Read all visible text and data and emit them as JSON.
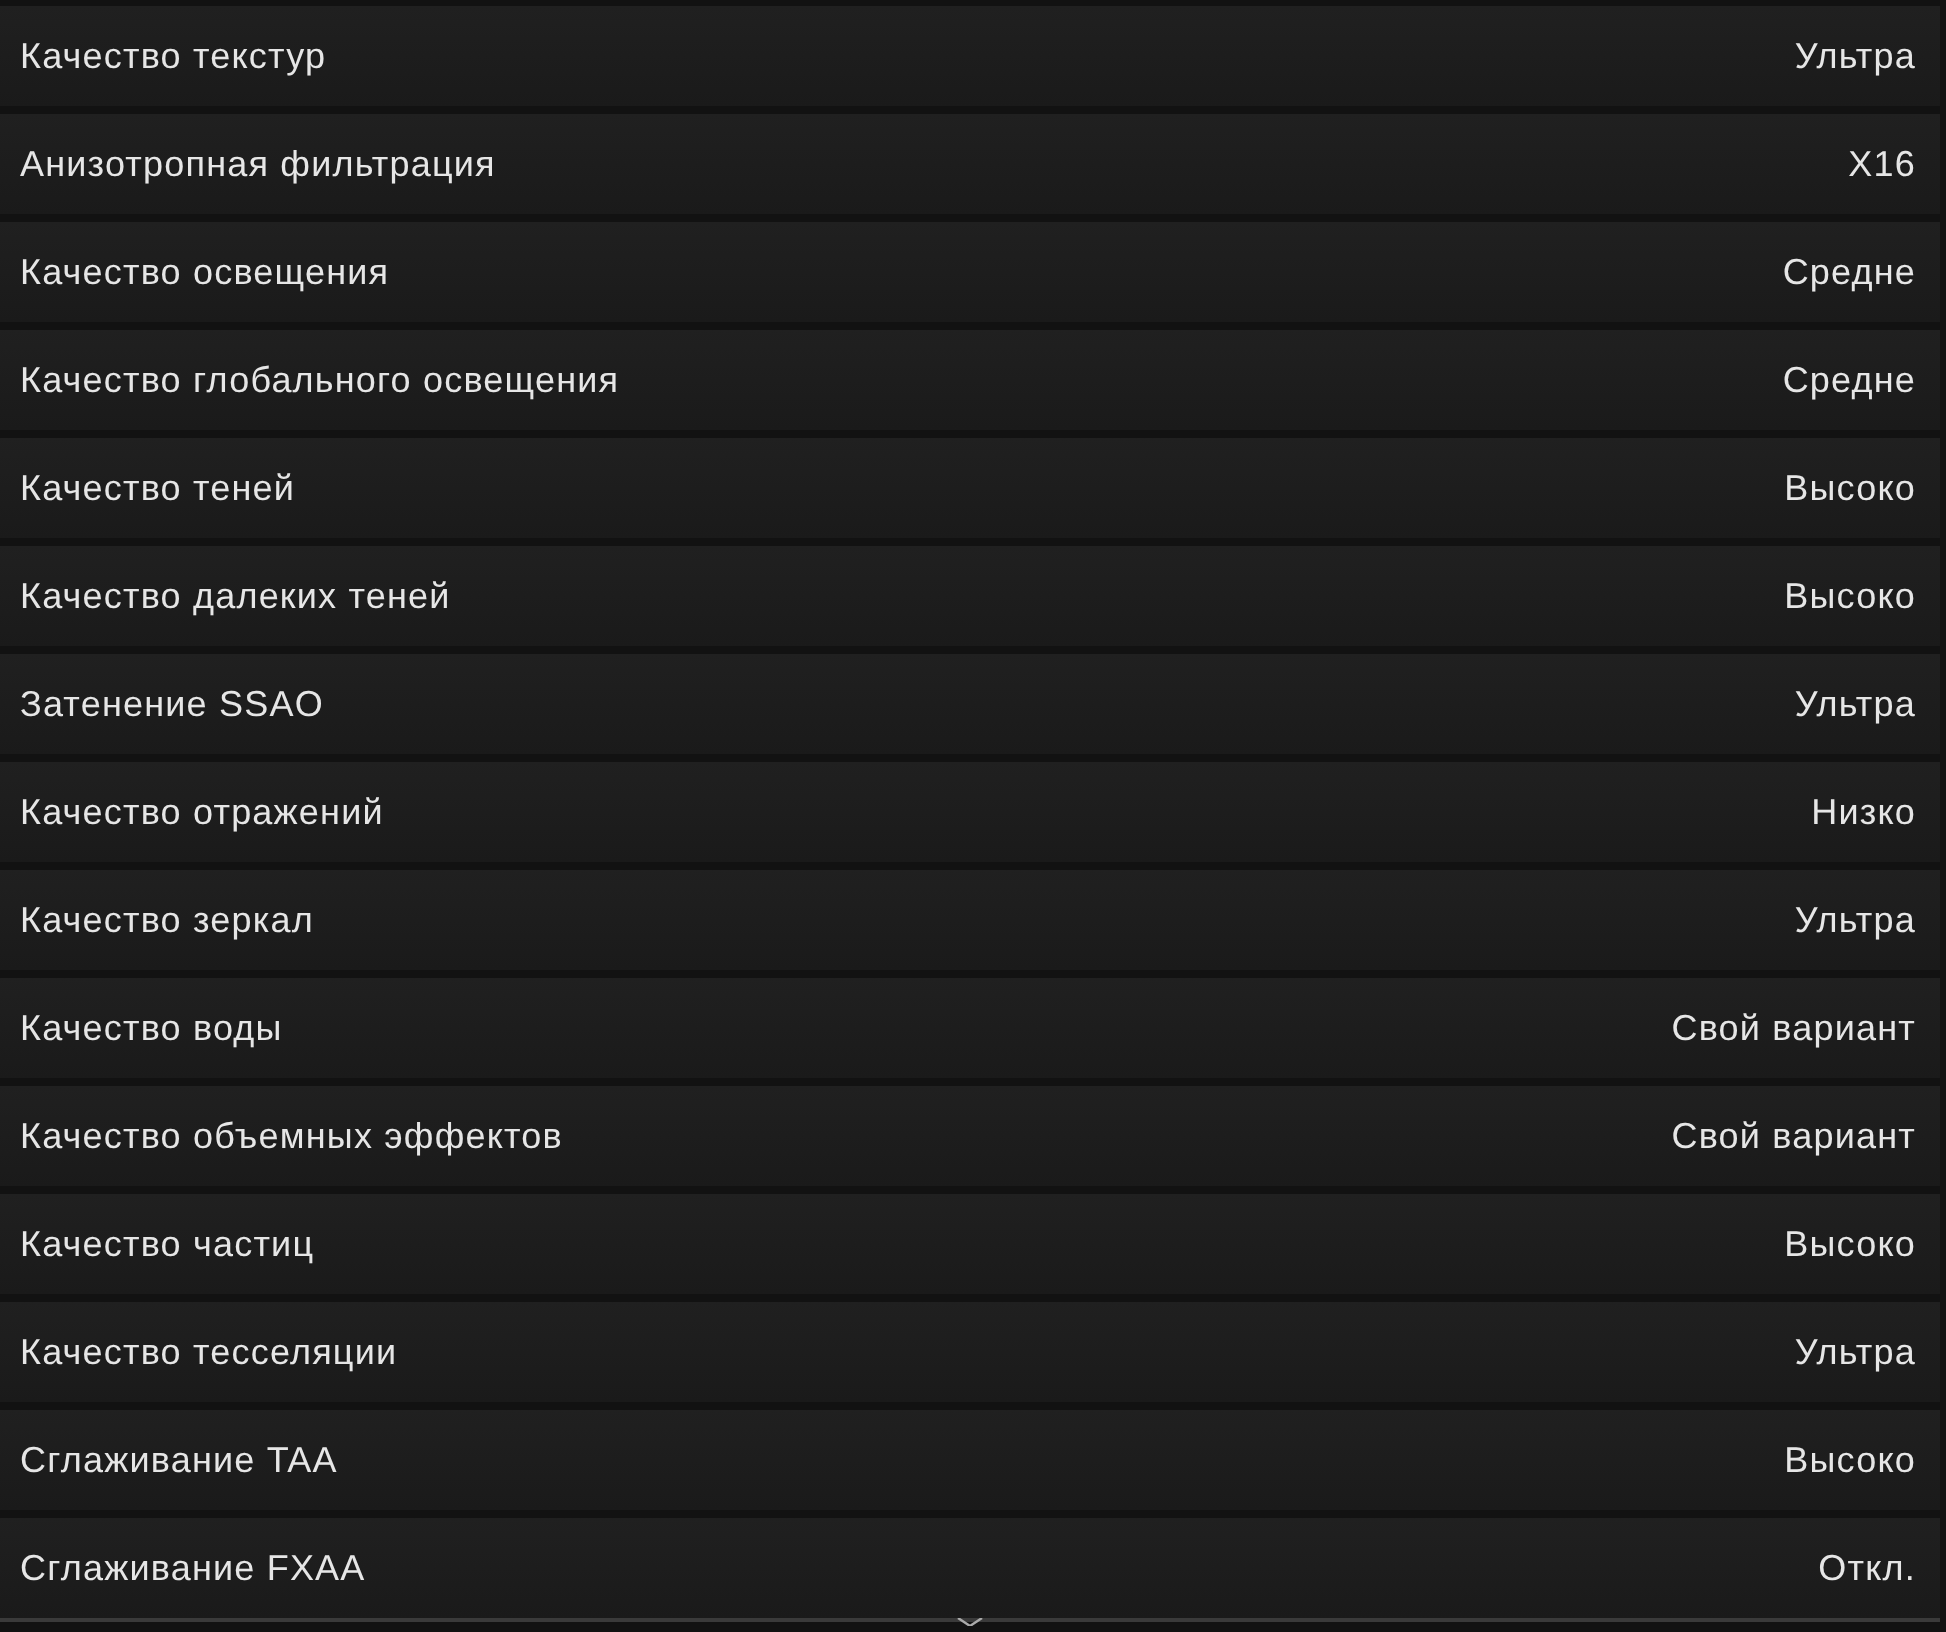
{
  "settings": [
    {
      "label": "Качество текстур",
      "value": "Ультра"
    },
    {
      "label": "Анизотропная фильтрация",
      "value": "X16"
    },
    {
      "label": "Качество освещения",
      "value": "Средне"
    },
    {
      "label": "Качество глобального освещения",
      "value": "Средне"
    },
    {
      "label": "Качество теней",
      "value": "Высоко"
    },
    {
      "label": "Качество далеких теней",
      "value": "Высоко"
    },
    {
      "label": "Затенение SSAO",
      "value": "Ультра"
    },
    {
      "label": "Качество отражений",
      "value": "Низко"
    },
    {
      "label": "Качество зеркал",
      "value": "Ультра"
    },
    {
      "label": "Качество воды",
      "value": "Свой вариант"
    },
    {
      "label": "Качество объемных эффектов",
      "value": "Свой вариант"
    },
    {
      "label": "Качество частиц",
      "value": "Высоко"
    },
    {
      "label": "Качество тесселяции",
      "value": "Ультра"
    },
    {
      "label": "Сглаживание TAA",
      "value": "Высоко"
    },
    {
      "label": "Сглаживание FXAA",
      "value": "Откл."
    }
  ]
}
